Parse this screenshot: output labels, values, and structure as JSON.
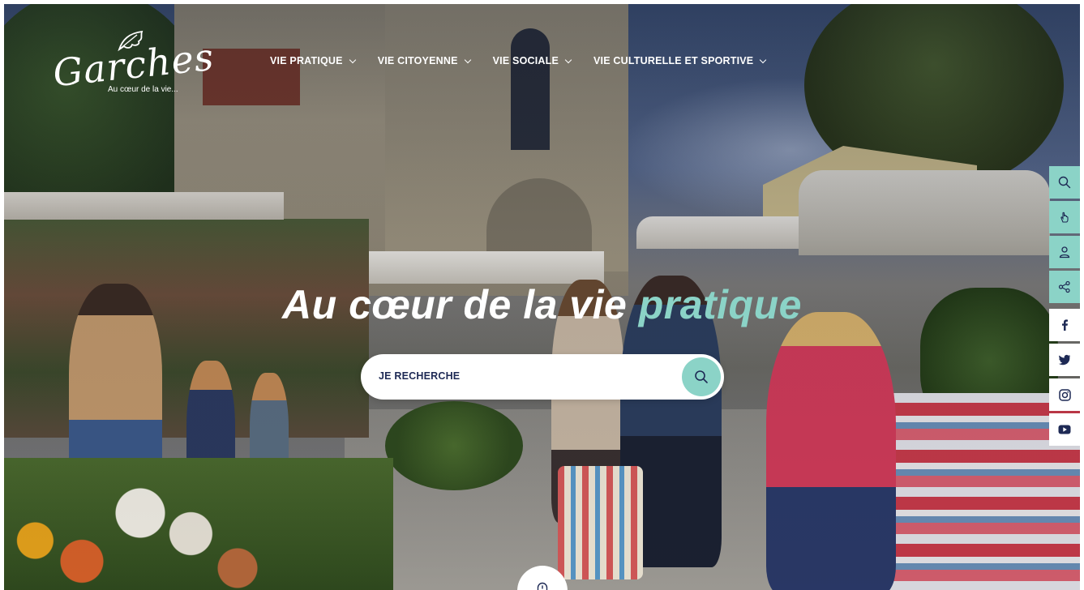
{
  "logo": {
    "name": "Garches",
    "tagline": "Au cœur de la vie..."
  },
  "nav": {
    "items": [
      {
        "label": "VIE PRATIQUE"
      },
      {
        "label": "VIE CITOYENNE"
      },
      {
        "label": "VIE SOCIALE"
      },
      {
        "label": "VIE CULTURELLE ET SPORTIVE"
      }
    ]
  },
  "hero": {
    "title_main": "Au cœur de la vie ",
    "title_accent": "pratique"
  },
  "search": {
    "label": "JE RECHERCHE"
  },
  "side_toolbar": {
    "icons": [
      "search-icon",
      "hand-pointer-icon",
      "user-icon",
      "share-icon",
      "facebook-icon",
      "twitter-icon",
      "instagram-icon",
      "youtube-icon"
    ]
  },
  "colors": {
    "accent": "#8bd3c7",
    "navy": "#1e2a55",
    "white": "#ffffff"
  }
}
